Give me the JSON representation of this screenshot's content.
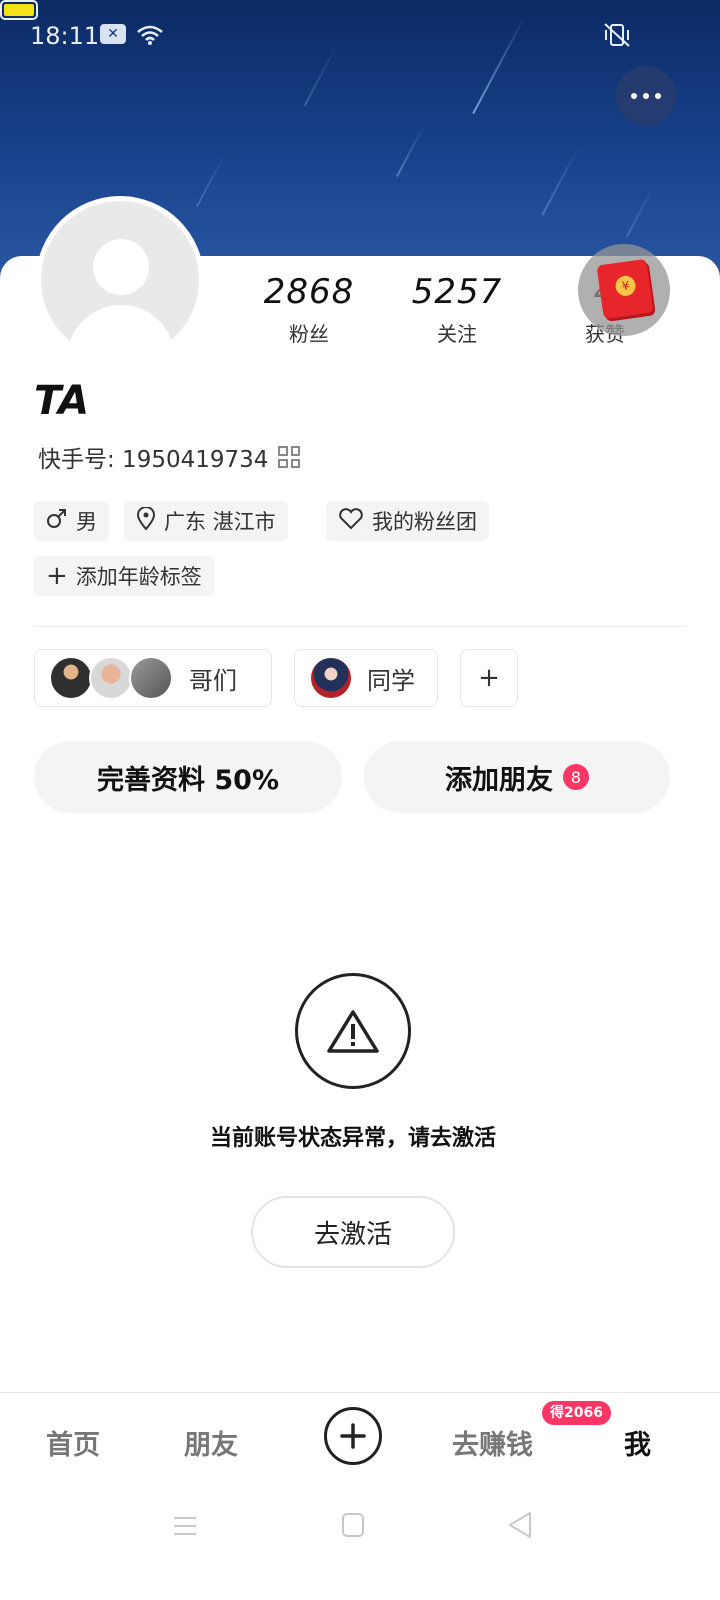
{
  "status_bar": {
    "time": "18:11",
    "notification_icon": "close-box-icon",
    "wifi_icon": "wifi-icon",
    "mute_icon": "vibrate-off-icon",
    "battery_icon": "battery-icon",
    "battery_color": "#f3e11a"
  },
  "header": {
    "more_icon": "more-horizontal-icon",
    "red_packet_icon": "red-envelope-icon"
  },
  "profile": {
    "stats": [
      {
        "value": "2868",
        "label": "粉丝"
      },
      {
        "value": "5257",
        "label": "关注"
      },
      {
        "value": "4",
        "label": "获赞"
      }
    ],
    "name": "TA",
    "user_id": "快手号: 1950419734",
    "qr_icon": "qr-code-icon",
    "tags": {
      "gender": "男",
      "location": "广东 湛江市",
      "fan_club": "我的粉丝团",
      "add_age": "添加年龄标签"
    },
    "groups": [
      {
        "label": "哥们"
      },
      {
        "label": "同学"
      }
    ],
    "add_group_symbol": "+"
  },
  "actions": {
    "complete_profile": "完善资料 50%",
    "add_friends": "添加朋友",
    "add_friends_badge": "8"
  },
  "notice": {
    "warning_icon": "warning-triangle-icon",
    "text": "当前账号状态异常，请去激活",
    "button": "去激活"
  },
  "bottom_nav": {
    "home": "首页",
    "friends": "朋友",
    "plus_icon": "plus-circle-icon",
    "earn": "去赚钱",
    "earn_badge": "得2066",
    "me": "我",
    "accent": "#fe3666"
  },
  "system_nav": {
    "menu_icon": "menu-icon",
    "home_icon": "square-home-icon",
    "back_icon": "back-triangle-icon"
  }
}
